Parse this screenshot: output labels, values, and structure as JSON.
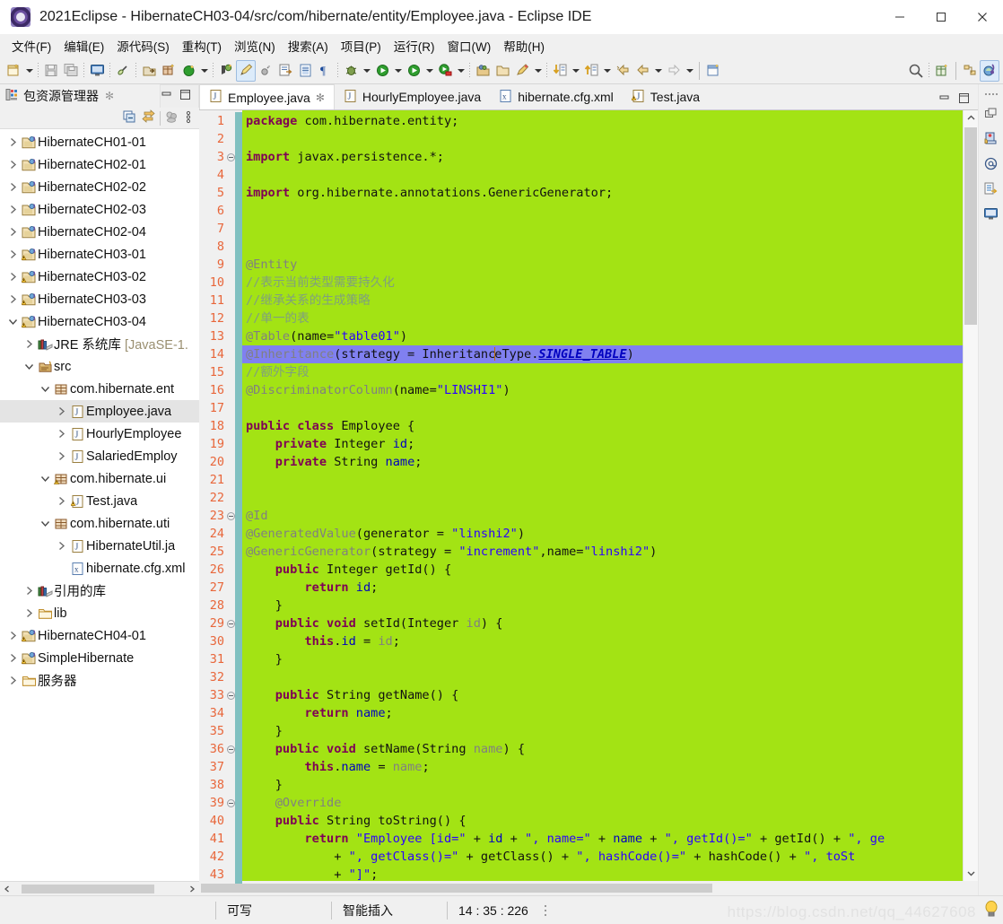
{
  "window": {
    "title": "2021Eclipse - HibernateCH03-04/src/com/hibernate/entity/Employee.java - Eclipse IDE",
    "app_icon": "eclipse-icon",
    "minimize_label": "—",
    "maximize_label": "□",
    "close_label": "✕"
  },
  "menubar": {
    "items": [
      {
        "label": "文件(F)",
        "name": "menu-file"
      },
      {
        "label": "编辑(E)",
        "name": "menu-edit"
      },
      {
        "label": "源代码(S)",
        "name": "menu-source"
      },
      {
        "label": "重构(T)",
        "name": "menu-refactor"
      },
      {
        "label": "浏览(N)",
        "name": "menu-navigate"
      },
      {
        "label": "搜索(A)",
        "name": "menu-search"
      },
      {
        "label": "项目(P)",
        "name": "menu-project"
      },
      {
        "label": "运行(R)",
        "name": "menu-run"
      },
      {
        "label": "窗口(W)",
        "name": "menu-window"
      },
      {
        "label": "帮助(H)",
        "name": "menu-help"
      }
    ]
  },
  "toolbar": {
    "icons": [
      "new-wizard-icon",
      "save-icon",
      "save-all-icon",
      "print-screen-icon",
      "link-break-icon",
      "export-icon",
      "new-package-icon",
      "refresh-icon",
      "new-java-project-icon",
      "edit-pencil-icon",
      "skip-breakpoints-icon",
      "open-type-icon",
      "open-task-icon",
      "paragraph-marks-icon",
      "debug-icon",
      "run-icon",
      "coverage-icon",
      "run-last-tool-icon",
      "external-tools-icon",
      "open-folder-icon",
      "open-resource-icon",
      "search-magnifier-icon",
      "new-class-icon",
      "perspective-icon",
      "java-perspective-icon"
    ],
    "search_placeholder": "",
    "selected_icon": "edit-pencil-icon"
  },
  "package_explorer": {
    "tab_label": "包资源管理器",
    "tab_icon": "package-explorer-icon",
    "close_icon": "close-icon",
    "minimize_icon": "minimize-icon",
    "maximize_icon": "maximize-icon",
    "view_tools": [
      "collapse-all-icon",
      "link-with-editor-icon",
      "filter-icon",
      "view-menu-icon"
    ],
    "tree": [
      {
        "label": "HibernateCH01-01",
        "depth": 0,
        "twist": "collapsed",
        "icon": "java-project-icon",
        "selected": false
      },
      {
        "label": "HibernateCH02-01",
        "depth": 0,
        "twist": "collapsed",
        "icon": "java-project-icon",
        "selected": false
      },
      {
        "label": "HibernateCH02-02",
        "depth": 0,
        "twist": "collapsed",
        "icon": "java-project-icon",
        "selected": false
      },
      {
        "label": "HibernateCH02-03",
        "depth": 0,
        "twist": "collapsed",
        "icon": "java-project-icon",
        "selected": false
      },
      {
        "label": "HibernateCH02-04",
        "depth": 0,
        "twist": "collapsed",
        "icon": "java-project-icon",
        "selected": false
      },
      {
        "label": "HibernateCH03-01",
        "depth": 0,
        "twist": "collapsed",
        "icon": "java-project-warning-icon",
        "selected": false
      },
      {
        "label": "HibernateCH03-02",
        "depth": 0,
        "twist": "collapsed",
        "icon": "java-project-warning-icon",
        "selected": false
      },
      {
        "label": "HibernateCH03-03",
        "depth": 0,
        "twist": "collapsed",
        "icon": "java-project-warning-icon",
        "selected": false
      },
      {
        "label": "HibernateCH03-04",
        "depth": 0,
        "twist": "expanded",
        "icon": "java-project-warning-icon",
        "selected": false
      },
      {
        "label": "JRE 系统库 ",
        "dim": "[JavaSE-1.",
        "depth": 1,
        "twist": "collapsed",
        "icon": "library-icon",
        "selected": false
      },
      {
        "label": "src",
        "depth": 1,
        "twist": "expanded",
        "icon": "source-folder-icon",
        "selected": false
      },
      {
        "label": "com.hibernate.ent",
        "depth": 2,
        "twist": "expanded",
        "icon": "package-icon",
        "selected": false
      },
      {
        "label": "Employee.java",
        "depth": 3,
        "twist": "collapsed",
        "icon": "java-file-icon",
        "selected": true
      },
      {
        "label": "HourlyEmployee",
        "depth": 3,
        "twist": "collapsed",
        "icon": "java-file-icon",
        "selected": false
      },
      {
        "label": "SalariedEmploy",
        "depth": 3,
        "twist": "collapsed",
        "icon": "java-file-icon",
        "selected": false
      },
      {
        "label": "com.hibernate.ui",
        "depth": 2,
        "twist": "expanded",
        "icon": "package-warning-icon",
        "selected": false
      },
      {
        "label": "Test.java",
        "depth": 3,
        "twist": "collapsed",
        "icon": "java-file-warning-icon",
        "selected": false
      },
      {
        "label": "com.hibernate.uti",
        "depth": 2,
        "twist": "expanded",
        "icon": "package-icon",
        "selected": false
      },
      {
        "label": "HibernateUtil.ja",
        "depth": 3,
        "twist": "collapsed",
        "icon": "java-file-icon",
        "selected": false
      },
      {
        "label": "hibernate.cfg.xml",
        "depth": 3,
        "twist": "none",
        "icon": "xml-file-icon",
        "selected": false
      },
      {
        "label": "引用的库",
        "depth": 1,
        "twist": "collapsed",
        "icon": "library-icon",
        "selected": false
      },
      {
        "label": "lib",
        "depth": 1,
        "twist": "collapsed",
        "icon": "folder-icon",
        "selected": false
      },
      {
        "label": "HibernateCH04-01",
        "depth": 0,
        "twist": "collapsed",
        "icon": "java-project-warning-icon",
        "selected": false
      },
      {
        "label": "SimpleHibernate",
        "depth": 0,
        "twist": "collapsed",
        "icon": "java-project-warning-icon",
        "selected": false
      },
      {
        "label": "服务器",
        "depth": 0,
        "twist": "collapsed",
        "icon": "folder-icon",
        "selected": false
      }
    ]
  },
  "editor": {
    "tabs": [
      {
        "label": "Employee.java",
        "icon": "java-file-icon",
        "active": true,
        "closeable": true
      },
      {
        "label": "HourlyEmployee.java",
        "icon": "java-file-icon",
        "active": false,
        "closeable": false
      },
      {
        "label": "hibernate.cfg.xml",
        "icon": "xml-file-icon",
        "active": false,
        "closeable": false
      },
      {
        "label": "Test.java",
        "icon": "java-file-warning-icon",
        "active": false,
        "closeable": false
      }
    ],
    "minimize_icon": "minimize-icon",
    "maximize_icon": "maximize-icon",
    "background_color": "#a3e314",
    "highlight_color": "#8080f0",
    "line_number_color": "#e8663a",
    "first_line": 1,
    "last_line": 43,
    "lines": [
      {
        "n": 1,
        "fold": false,
        "change": true,
        "html": "<span class=\"k\">package</span> com.hibernate.entity;"
      },
      {
        "n": 2,
        "fold": false,
        "change": true,
        "html": ""
      },
      {
        "n": 3,
        "fold": true,
        "change": true,
        "html": "<span class=\"k\">import</span> javax.persistence.*;"
      },
      {
        "n": 4,
        "fold": false,
        "change": true,
        "html": ""
      },
      {
        "n": 5,
        "fold": false,
        "change": true,
        "html": "<span class=\"k\">import</span> org.hibernate.annotations.GenericGenerator;"
      },
      {
        "n": 6,
        "fold": false,
        "change": true,
        "html": ""
      },
      {
        "n": 7,
        "fold": false,
        "change": true,
        "html": ""
      },
      {
        "n": 8,
        "fold": false,
        "change": true,
        "html": ""
      },
      {
        "n": 9,
        "fold": false,
        "change": true,
        "html": "<span class=\"a\">@Entity</span>"
      },
      {
        "n": 10,
        "fold": false,
        "change": true,
        "html": "<span class=\"cm\">//表示当前类型需要持久化</span>"
      },
      {
        "n": 11,
        "fold": false,
        "change": true,
        "html": "<span class=\"cm\">//继承关系的生成策略</span>"
      },
      {
        "n": 12,
        "fold": false,
        "change": true,
        "html": "<span class=\"cm\">//单一的表</span>"
      },
      {
        "n": 13,
        "fold": false,
        "change": true,
        "html": "<span class=\"a\">@Table</span>(name=<span class=\"s\">\"table01\"</span>)"
      },
      {
        "n": 14,
        "fold": false,
        "change": true,
        "hl": true,
        "html": "<span class=\"a\">@Inheritance</span>(strategy = Inheritanc<span class=\"caret\"></span>eType.<span class=\"st\">SINGLE_TABLE</span>)"
      },
      {
        "n": 15,
        "fold": false,
        "change": true,
        "html": "<span class=\"cm\">//额外字段</span>"
      },
      {
        "n": 16,
        "fold": false,
        "change": true,
        "html": "<span class=\"a\">@DiscriminatorColumn</span>(name=<span class=\"s\">\"LINSHI1\"</span>)"
      },
      {
        "n": 17,
        "fold": false,
        "change": true,
        "html": ""
      },
      {
        "n": 18,
        "fold": false,
        "change": true,
        "html": "<span class=\"k\">public class</span> Employee {"
      },
      {
        "n": 19,
        "fold": false,
        "change": true,
        "html": "    <span class=\"k\">private</span> Integer <span class=\"f\">id</span>;"
      },
      {
        "n": 20,
        "fold": false,
        "change": true,
        "html": "    <span class=\"k\">private</span> String <span class=\"f\">name</span>;"
      },
      {
        "n": 21,
        "fold": false,
        "change": true,
        "html": ""
      },
      {
        "n": 22,
        "fold": false,
        "change": true,
        "html": ""
      },
      {
        "n": 23,
        "fold": true,
        "change": true,
        "html": "<span class=\"a\">@Id</span>"
      },
      {
        "n": 24,
        "fold": false,
        "change": true,
        "html": "<span class=\"a\">@GeneratedValue</span>(generator = <span class=\"s\">\"linshi2\"</span>)"
      },
      {
        "n": 25,
        "fold": false,
        "change": true,
        "html": "<span class=\"a\">@GenericGenerator</span>(strategy = <span class=\"s\">\"increment\"</span>,name=<span class=\"s\">\"linshi2\"</span>)"
      },
      {
        "n": 26,
        "fold": false,
        "change": true,
        "html": "    <span class=\"k\">public</span> Integer getId() {"
      },
      {
        "n": 27,
        "fold": false,
        "change": true,
        "html": "        <span class=\"k\">return</span> <span class=\"f\">id</span>;"
      },
      {
        "n": 28,
        "fold": false,
        "change": true,
        "html": "    }"
      },
      {
        "n": 29,
        "fold": true,
        "change": true,
        "html": "    <span class=\"k\">public void</span> setId(Integer <span class=\"a\">id</span>) {"
      },
      {
        "n": 30,
        "fold": false,
        "change": true,
        "html": "        <span class=\"k\">this</span>.<span class=\"f\">id</span> = <span class=\"a\">id</span>;"
      },
      {
        "n": 31,
        "fold": false,
        "change": true,
        "html": "    }"
      },
      {
        "n": 32,
        "fold": false,
        "change": true,
        "html": ""
      },
      {
        "n": 33,
        "fold": true,
        "change": true,
        "html": "    <span class=\"k\">public</span> String getName() {"
      },
      {
        "n": 34,
        "fold": false,
        "change": true,
        "html": "        <span class=\"k\">return</span> <span class=\"f\">name</span>;"
      },
      {
        "n": 35,
        "fold": false,
        "change": true,
        "html": "    }"
      },
      {
        "n": 36,
        "fold": true,
        "change": true,
        "html": "    <span class=\"k\">public void</span> setName(String <span class=\"a\">name</span>) {"
      },
      {
        "n": 37,
        "fold": false,
        "change": true,
        "html": "        <span class=\"k\">this</span>.<span class=\"f\">name</span> = <span class=\"a\">name</span>;"
      },
      {
        "n": 38,
        "fold": false,
        "change": true,
        "html": "    }"
      },
      {
        "n": 39,
        "fold": true,
        "change": true,
        "html": "    <span class=\"a\">@Override</span>"
      },
      {
        "n": 40,
        "fold": false,
        "change": true,
        "html": "    <span class=\"k\">public</span> String toString() {"
      },
      {
        "n": 41,
        "fold": false,
        "change": true,
        "html": "        <span class=\"k\">return</span> <span class=\"s\">\"Employee [id=\"</span> + <span class=\"f\">id</span> + <span class=\"s\">\", name=\"</span> + <span class=\"f\">name</span> + <span class=\"s\">\", getId()=\"</span> + getId() + <span class=\"s\">\", ge</span>"
      },
      {
        "n": 42,
        "fold": false,
        "change": true,
        "html": "            + <span class=\"s\">\", getClass()=\"</span> + getClass() + <span class=\"s\">\", hashCode()=\"</span> + hashCode() + <span class=\"s\">\", toSt</span>"
      },
      {
        "n": 43,
        "fold": false,
        "change": true,
        "html": "            + <span class=\"s\">\"]\"</span>;"
      }
    ]
  },
  "right_bar": {
    "icons": [
      "restore-icon",
      "servers-view-icon",
      "at-outline-icon",
      "console-view-icon",
      "display-view-icon"
    ]
  },
  "statusbar": {
    "writable": "可写",
    "insert_mode": "智能插入",
    "position": "14 : 35 : 226",
    "watermark": "https://blog.csdn.net/qq_44627608",
    "bulb_icon": "quick-fix-bulb-icon"
  }
}
